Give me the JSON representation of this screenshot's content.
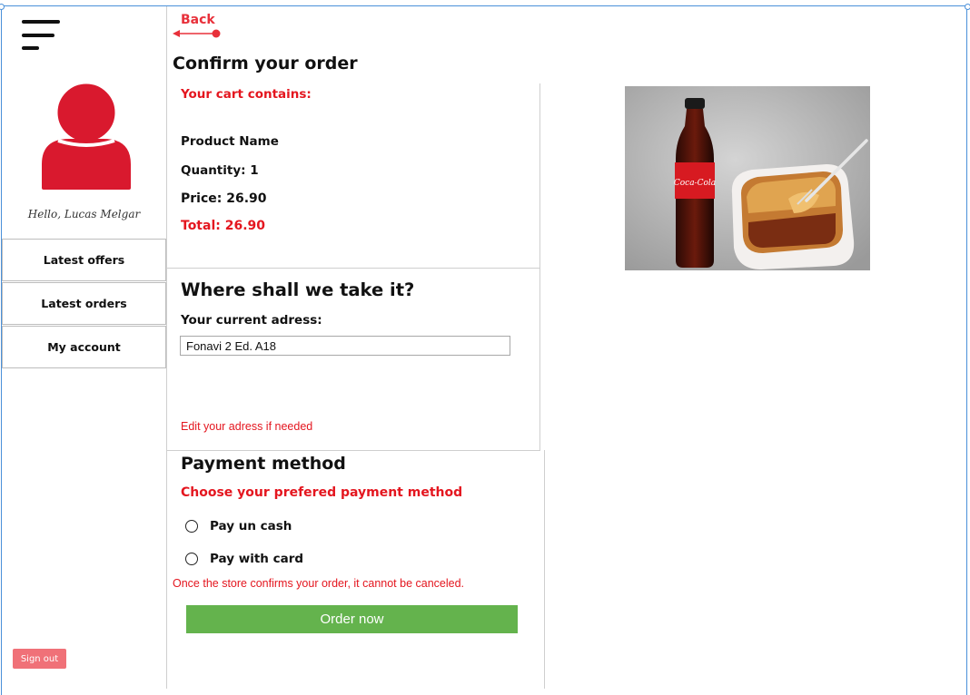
{
  "sidebar": {
    "greeting": "Hello, Lucas Melgar",
    "items": [
      {
        "label": "Latest offers"
      },
      {
        "label": "Latest orders"
      },
      {
        "label": "My account"
      }
    ],
    "sign_out_label": "Sign out"
  },
  "header": {
    "back_label": "Back",
    "title": "Confirm your order"
  },
  "cart": {
    "heading": "Your cart contains:",
    "product_name": "Product Name",
    "quantity": "Quantity: 1",
    "price": "Price: 26.90",
    "total": "Total: 26.90"
  },
  "delivery": {
    "heading": "Where shall we take it?",
    "address_label": "Your current adress:",
    "address_value": "Fonavi 2 Ed. A18",
    "edit_hint": "Edit your adress if needed"
  },
  "payment": {
    "heading": "Payment method",
    "subheading": "Choose your prefered payment method",
    "options": [
      {
        "label": "Pay un cash",
        "selected": false
      },
      {
        "label": "Pay with card",
        "selected": false
      }
    ],
    "warning": "Once the store confirms your order, it cannot be canceled.",
    "order_button": "Order now"
  },
  "product_image": {
    "bottle_label": "Coca-Cola"
  },
  "colors": {
    "accent_red": "#e4161f",
    "back_red": "#e8303a",
    "avatar_red": "#d9192e",
    "order_green": "#64b34d",
    "sign_out": "#f07178",
    "frame_blue": "#4a90d9"
  },
  "icons": [
    "hamburger-menu-icon",
    "user-avatar-icon",
    "back-arrow-icon"
  ]
}
